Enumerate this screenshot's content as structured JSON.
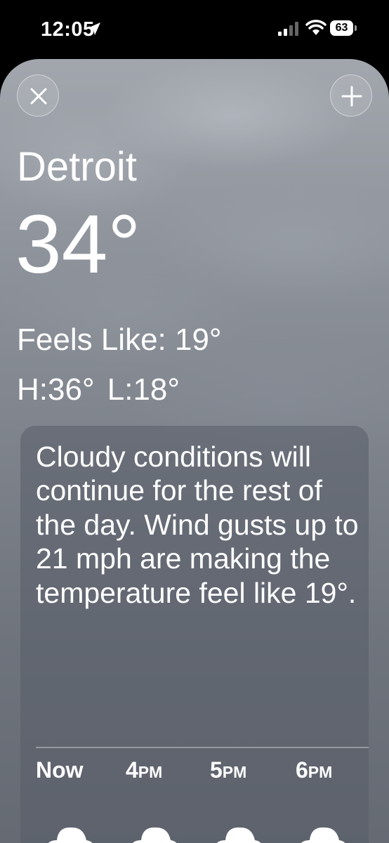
{
  "status": {
    "time": "12:05",
    "battery": "63"
  },
  "weather": {
    "city": "Detroit",
    "temperature": "34°",
    "feels_like": "Feels Like: 19°",
    "high_low": "H:36°  L:18°",
    "summary": "Cloudy conditions will continue for the rest of the day. Wind gusts up to 21 mph are making the temperature feel like 19°."
  },
  "hourly": [
    {
      "num": "Now",
      "suffix": "",
      "icon": "cloud-icon"
    },
    {
      "num": "4",
      "suffix": "PM",
      "icon": "cloud-icon"
    },
    {
      "num": "5",
      "suffix": "PM",
      "icon": "cloud-icon"
    },
    {
      "num": "6",
      "suffix": "PM",
      "icon": "cloud-icon"
    }
  ],
  "icons": {
    "close": "close-icon",
    "add": "plus-icon",
    "location": "location-arrow-icon",
    "signal": "cellular-signal-icon",
    "wifi": "wifi-icon",
    "battery": "battery-icon"
  }
}
